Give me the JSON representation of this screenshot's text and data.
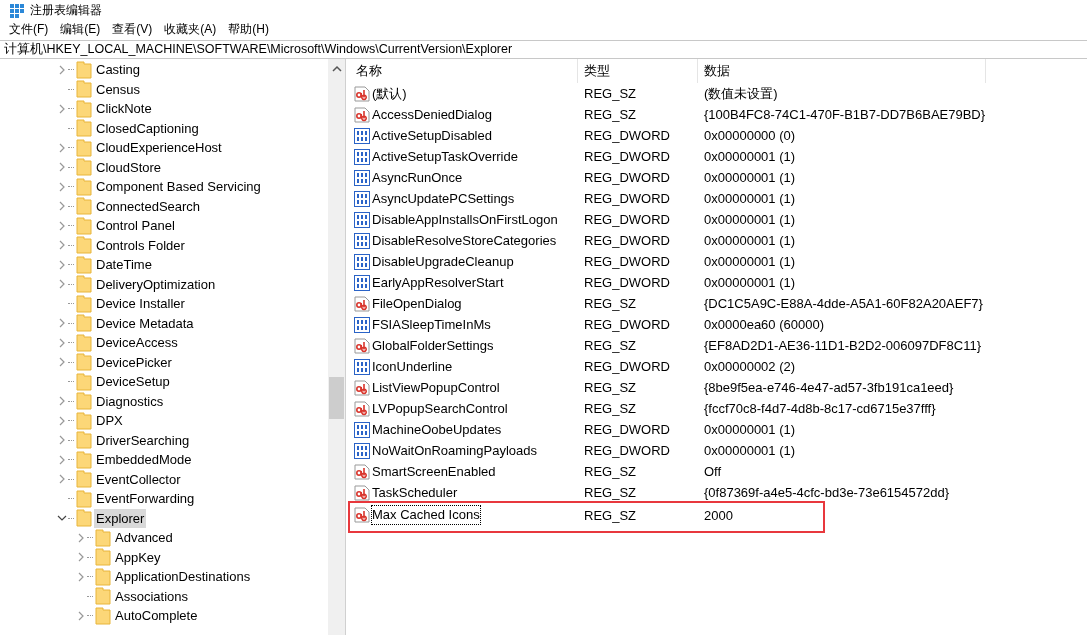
{
  "window": {
    "title": "注册表编辑器"
  },
  "menu": [
    "文件(F)",
    "编辑(E)",
    "查看(V)",
    "收藏夹(A)",
    "帮助(H)"
  ],
  "address": "计算机\\HKEY_LOCAL_MACHINE\\SOFTWARE\\Microsoft\\Windows\\CurrentVersion\\Explorer",
  "tree": [
    {
      "label": "Casting",
      "expandable": true,
      "expanded": false,
      "selected": false
    },
    {
      "label": "Census",
      "expandable": false,
      "expanded": false,
      "selected": false
    },
    {
      "label": "ClickNote",
      "expandable": true,
      "expanded": false,
      "selected": false
    },
    {
      "label": "ClosedCaptioning",
      "expandable": false,
      "expanded": false,
      "selected": false
    },
    {
      "label": "CloudExperienceHost",
      "expandable": true,
      "expanded": false,
      "selected": false
    },
    {
      "label": "CloudStore",
      "expandable": true,
      "expanded": false,
      "selected": false
    },
    {
      "label": "Component Based Servicing",
      "expandable": true,
      "expanded": false,
      "selected": false
    },
    {
      "label": "ConnectedSearch",
      "expandable": true,
      "expanded": false,
      "selected": false
    },
    {
      "label": "Control Panel",
      "expandable": true,
      "expanded": false,
      "selected": false
    },
    {
      "label": "Controls Folder",
      "expandable": true,
      "expanded": false,
      "selected": false
    },
    {
      "label": "DateTime",
      "expandable": true,
      "expanded": false,
      "selected": false
    },
    {
      "label": "DeliveryOptimization",
      "expandable": true,
      "expanded": false,
      "selected": false
    },
    {
      "label": "Device Installer",
      "expandable": false,
      "expanded": false,
      "selected": false
    },
    {
      "label": "Device Metadata",
      "expandable": true,
      "expanded": false,
      "selected": false
    },
    {
      "label": "DeviceAccess",
      "expandable": true,
      "expanded": false,
      "selected": false
    },
    {
      "label": "DevicePicker",
      "expandable": true,
      "expanded": false,
      "selected": false
    },
    {
      "label": "DeviceSetup",
      "expandable": false,
      "expanded": false,
      "selected": false
    },
    {
      "label": "Diagnostics",
      "expandable": true,
      "expanded": false,
      "selected": false
    },
    {
      "label": "DPX",
      "expandable": true,
      "expanded": false,
      "selected": false
    },
    {
      "label": "DriverSearching",
      "expandable": true,
      "expanded": false,
      "selected": false
    },
    {
      "label": "EmbeddedMode",
      "expandable": true,
      "expanded": false,
      "selected": false
    },
    {
      "label": "EventCollector",
      "expandable": true,
      "expanded": false,
      "selected": false
    },
    {
      "label": "EventForwarding",
      "expandable": false,
      "expanded": false,
      "selected": false
    },
    {
      "label": "Explorer",
      "expandable": true,
      "expanded": true,
      "selected": true,
      "children": [
        {
          "label": "Advanced",
          "expandable": true,
          "expanded": false,
          "selected": false
        },
        {
          "label": "AppKey",
          "expandable": true,
          "expanded": false,
          "selected": false
        },
        {
          "label": "ApplicationDestinations",
          "expandable": true,
          "expanded": false,
          "selected": false
        },
        {
          "label": "Associations",
          "expandable": false,
          "expanded": false,
          "selected": false
        },
        {
          "label": "AutoComplete",
          "expandable": true,
          "expanded": false,
          "selected": false
        }
      ]
    }
  ],
  "table": {
    "columns": [
      "名称",
      "类型",
      "数据"
    ],
    "rows": [
      {
        "kind": "string",
        "name": "(默认)",
        "type": "REG_SZ",
        "data": "(数值未设置)",
        "highlighted": false
      },
      {
        "kind": "string",
        "name": "AccessDeniedDialog",
        "type": "REG_SZ",
        "data": "{100B4FC8-74C1-470F-B1B7-DD7B6BAE79BD}",
        "highlighted": false
      },
      {
        "kind": "dword",
        "name": "ActiveSetupDisabled",
        "type": "REG_DWORD",
        "data": "0x00000000 (0)",
        "highlighted": false
      },
      {
        "kind": "dword",
        "name": "ActiveSetupTaskOverride",
        "type": "REG_DWORD",
        "data": "0x00000001 (1)",
        "highlighted": false
      },
      {
        "kind": "dword",
        "name": "AsyncRunOnce",
        "type": "REG_DWORD",
        "data": "0x00000001 (1)",
        "highlighted": false
      },
      {
        "kind": "dword",
        "name": "AsyncUpdatePCSettings",
        "type": "REG_DWORD",
        "data": "0x00000001 (1)",
        "highlighted": false
      },
      {
        "kind": "dword",
        "name": "DisableAppInstallsOnFirstLogon",
        "type": "REG_DWORD",
        "data": "0x00000001 (1)",
        "highlighted": false
      },
      {
        "kind": "dword",
        "name": "DisableResolveStoreCategories",
        "type": "REG_DWORD",
        "data": "0x00000001 (1)",
        "highlighted": false
      },
      {
        "kind": "dword",
        "name": "DisableUpgradeCleanup",
        "type": "REG_DWORD",
        "data": "0x00000001 (1)",
        "highlighted": false
      },
      {
        "kind": "dword",
        "name": "EarlyAppResolverStart",
        "type": "REG_DWORD",
        "data": "0x00000001 (1)",
        "highlighted": false
      },
      {
        "kind": "string",
        "name": "FileOpenDialog",
        "type": "REG_SZ",
        "data": "{DC1C5A9C-E88A-4dde-A5A1-60F82A20AEF7}",
        "highlighted": false
      },
      {
        "kind": "dword",
        "name": "FSIASleepTimeInMs",
        "type": "REG_DWORD",
        "data": "0x0000ea60 (60000)",
        "highlighted": false
      },
      {
        "kind": "string",
        "name": "GlobalFolderSettings",
        "type": "REG_SZ",
        "data": "{EF8AD2D1-AE36-11D1-B2D2-006097DF8C11}",
        "highlighted": false
      },
      {
        "kind": "dword",
        "name": "IconUnderline",
        "type": "REG_DWORD",
        "data": "0x00000002 (2)",
        "highlighted": false
      },
      {
        "kind": "string",
        "name": "ListViewPopupControl",
        "type": "REG_SZ",
        "data": "{8be9f5ea-e746-4e47-ad57-3fb191ca1eed}",
        "highlighted": false
      },
      {
        "kind": "string",
        "name": "LVPopupSearchControl",
        "type": "REG_SZ",
        "data": "{fccf70c8-f4d7-4d8b-8c17-cd6715e37fff}",
        "highlighted": false
      },
      {
        "kind": "dword",
        "name": "MachineOobeUpdates",
        "type": "REG_DWORD",
        "data": "0x00000001 (1)",
        "highlighted": false
      },
      {
        "kind": "dword",
        "name": "NoWaitOnRoamingPayloads",
        "type": "REG_DWORD",
        "data": "0x00000001 (1)",
        "highlighted": false
      },
      {
        "kind": "string",
        "name": "SmartScreenEnabled",
        "type": "REG_SZ",
        "data": "Off",
        "highlighted": false
      },
      {
        "kind": "string",
        "name": "TaskScheduler",
        "type": "REG_SZ",
        "data": "{0f87369f-a4e5-4cfc-bd3e-73e6154572dd}",
        "highlighted": false
      },
      {
        "kind": "string",
        "name": "Max Cached Icons",
        "type": "REG_SZ",
        "data": "2000",
        "highlighted": true
      }
    ]
  }
}
